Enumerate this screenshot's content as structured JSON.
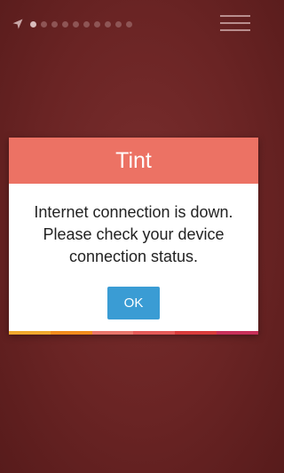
{
  "status_bar": {
    "location_icon": "location-arrow-icon",
    "page_count": 10,
    "active_page": 1,
    "menu_icon": "hamburger-menu-icon"
  },
  "dialog": {
    "title": "Tint",
    "message_lines": [
      "Internet connection is down.",
      "Please check your device",
      "connection status."
    ],
    "ok_label": "OK",
    "colors": {
      "header": "#ec7264",
      "button": "#3a9cd4",
      "strip": [
        "#f0a92e",
        "#f28c1d",
        "#e8766c",
        "#e45a58",
        "#d93c3c",
        "#c8305a"
      ]
    }
  }
}
